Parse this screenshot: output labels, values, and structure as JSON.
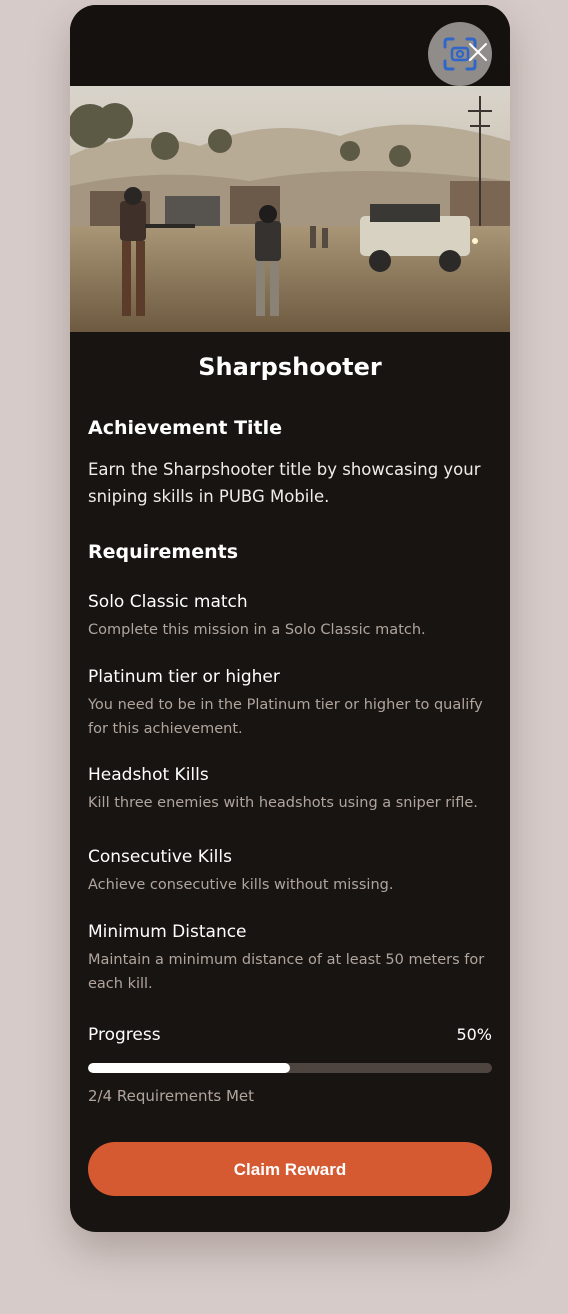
{
  "title": "Sharpshooter",
  "achievement": {
    "heading": "Achievement Title",
    "description": "Earn the Sharpshooter title by showcasing your sniping skills in PUBG Mobile."
  },
  "requirements": {
    "heading": "Requirements",
    "items": [
      {
        "title": "Solo Classic match",
        "description": "Complete this mission in a Solo Classic match."
      },
      {
        "title": "Platinum tier or higher",
        "description": "You need to be in the Platinum tier or higher to qualify for this achievement."
      },
      {
        "title": "Headshot Kills",
        "description": "Kill three enemies with headshots using a sniper rifle."
      },
      {
        "title": "Consecutive Kills",
        "description": "Achieve consecutive kills without missing."
      },
      {
        "title": "Minimum Distance",
        "description": "Maintain a minimum distance of at least 50 meters for each kill."
      }
    ]
  },
  "progress": {
    "label": "Progress",
    "percent_text": "50%",
    "fraction": 0.5,
    "status": "2/4 Requirements Met"
  },
  "claim_button": "Claim Reward",
  "colors": {
    "accent": "#d65a31",
    "card_bg": "#181411",
    "page_bg": "#d6cbc9"
  },
  "icons": {
    "scan": "scan-icon",
    "close": "close-icon"
  }
}
